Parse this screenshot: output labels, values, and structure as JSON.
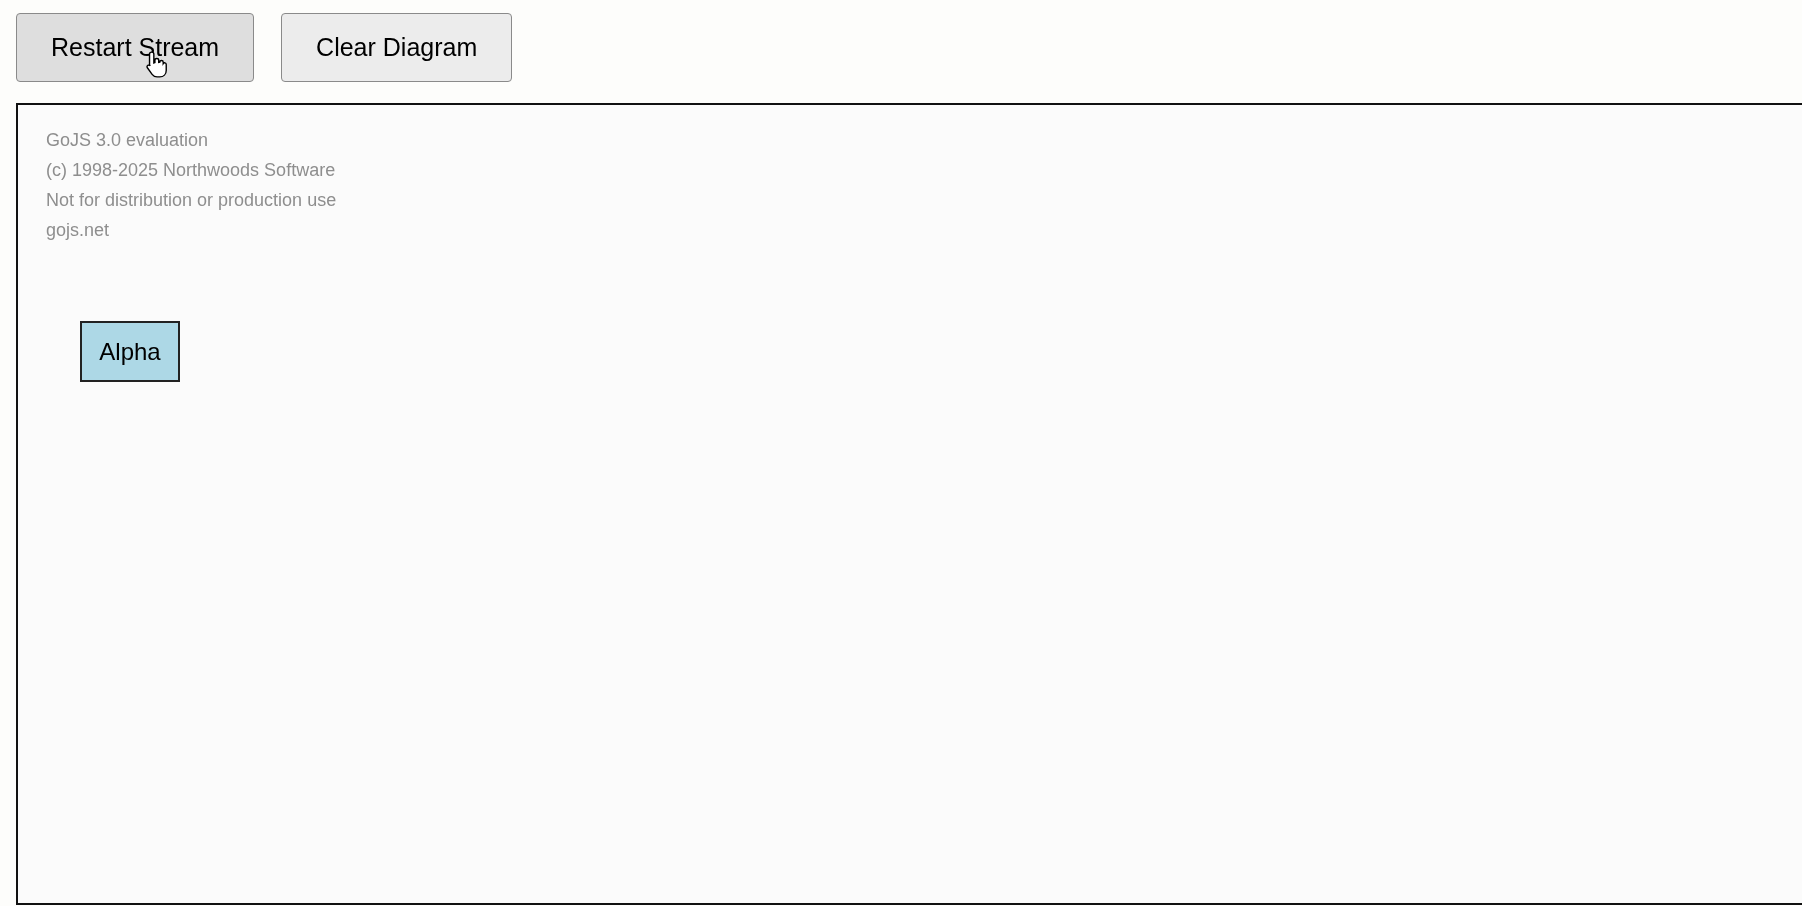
{
  "toolbar": {
    "buttons": [
      {
        "label": "Restart Stream",
        "hovered": true
      },
      {
        "label": "Clear Diagram",
        "hovered": false
      }
    ]
  },
  "diagram": {
    "watermark": [
      "GoJS 3.0 evaluation",
      "(c) 1998-2025 Northwoods Software",
      "Not for distribution or production use",
      "gojs.net"
    ],
    "nodes": [
      {
        "label": "Alpha",
        "color": "#add8e6"
      }
    ]
  }
}
